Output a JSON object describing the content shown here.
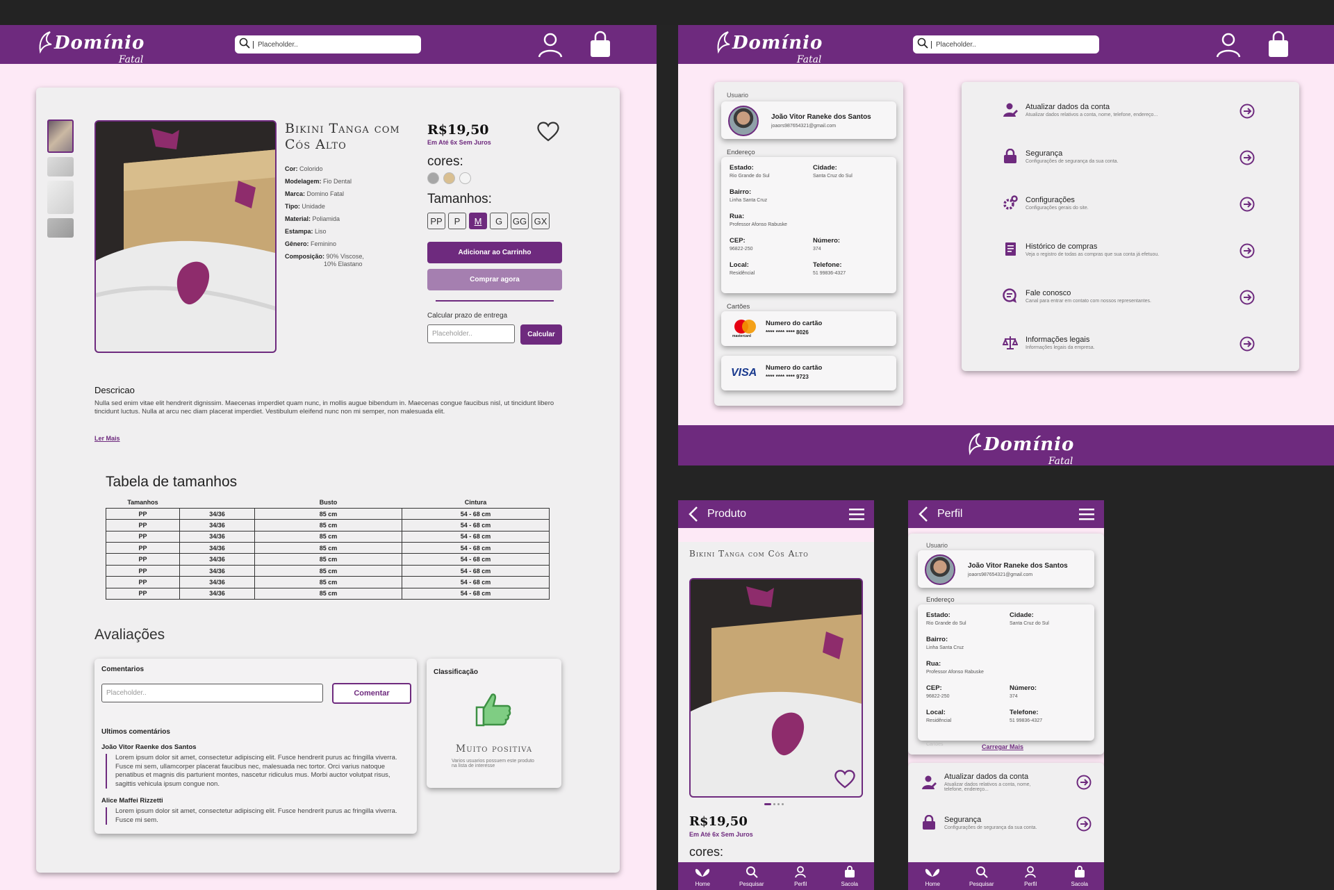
{
  "brand": {
    "name": "Domínio",
    "sub": "Fatal"
  },
  "search": {
    "placeholder": "Placeholder.."
  },
  "product": {
    "title": "Bikini Tanga com Cós Alto",
    "price": "R$19,50",
    "installments": "Em Até 6x Sem Juros",
    "colors_label": "cores:",
    "colors": [
      "#a6a6a6",
      "#d9bf91",
      "#f4f4f4"
    ],
    "sizes_label": "Tamanhos:",
    "sizes": [
      "PP",
      "P",
      "M",
      "G",
      "GG",
      "GX"
    ],
    "selected_size": "M",
    "add_cart": "Adicionar ao Carrinho",
    "buy_now": "Comprar agora",
    "shipping_label": "Calcular prazo de entrega",
    "shipping_placeholder": "Placeholder..",
    "calc_btn": "Calcular",
    "specs": [
      {
        "k": "Cor:",
        "v": "Colorido"
      },
      {
        "k": "Modelagem:",
        "v": "Fio Dental"
      },
      {
        "k": "Marca:",
        "v": "Domino Fatal"
      },
      {
        "k": "Tipo:",
        "v": "Unidade"
      },
      {
        "k": "Material:",
        "v": "Poliamida"
      },
      {
        "k": "Estampa:",
        "v": "Liso"
      },
      {
        "k": "Gênero:",
        "v": "Feminino"
      },
      {
        "k": "Composição:",
        "v": "90% Viscose,"
      },
      {
        "k": "",
        "v": "10% Elastano"
      }
    ],
    "desc_title": "Descricao",
    "desc_text": "Nulla sed enim vitae elit hendrerit dignissim. Maecenas imperdiet quam nunc, in mollis augue bibendum in. Maecenas congue faucibus nisl, ut tincidunt libero tincidunt luctus. Nulla at arcu nec diam placerat imperdiet. Vestibulum eleifend nunc non mi semper, non malesuada elit.",
    "read_more": "Ler Mais"
  },
  "size_table": {
    "title": "Tabela de tamanhos",
    "headers": [
      "Tamanhos",
      "",
      "Busto",
      "Cintura"
    ],
    "rows": [
      [
        "PP",
        "34/36",
        "85 cm",
        "54 - 68 cm"
      ],
      [
        "PP",
        "34/36",
        "85 cm",
        "54 - 68 cm"
      ],
      [
        "PP",
        "34/36",
        "85 cm",
        "54 - 68 cm"
      ],
      [
        "PP",
        "34/36",
        "85 cm",
        "54 - 68 cm"
      ],
      [
        "PP",
        "34/36",
        "85 cm",
        "54 - 68 cm"
      ],
      [
        "PP",
        "34/36",
        "85 cm",
        "54 - 68 cm"
      ],
      [
        "PP",
        "34/36",
        "85 cm",
        "54 - 68 cm"
      ],
      [
        "PP",
        "34/36",
        "85 cm",
        "54 - 68 cm"
      ]
    ]
  },
  "reviews": {
    "title": "Avaliações",
    "comments_label": "Comentarios",
    "comment_placeholder": "Placeholder..",
    "comment_btn": "Comentar",
    "latest": "Ultimos comentários",
    "items": [
      {
        "author": "João Vitor Raenke dos Santos",
        "text": "Lorem ipsum dolor sit amet, consectetur adipiscing elit. Fusce hendrerit purus ac fringilla viverra. Fusce mi sem, ullamcorper placerat faucibus nec, malesuada nec tortor. Orci varius natoque penatibus et magnis dis parturient montes, nascetur ridiculus mus. Morbi auctor volutpat risus, sagittis vehicula ipsum congue non."
      },
      {
        "author": "Alice Maffei Rizzetti",
        "text": "Lorem ipsum dolor sit amet, consectetur adipiscing elit. Fusce hendrerit purus ac fringilla viverra. Fusce mi sem."
      }
    ],
    "rating_label": "Classificação",
    "rating_value": "Muito positiva",
    "rating_note": "Varios usuarios possuem este produto na lista de interesse"
  },
  "profile": {
    "user_label": "Usuario",
    "name": "João Vitor Raneke dos Santos",
    "email": "joaors987654321@gmail.com",
    "address_label": "Endereço",
    "address": [
      {
        "k": "Estado:",
        "v": "Rio Grande do Sul"
      },
      {
        "k": "Cidade:",
        "v": "Santa Cruz do Sul"
      },
      {
        "k": "Bairro:",
        "v": "Linha Santa Cruz"
      },
      {
        "k": "Rua:",
        "v": "Professor Afonso Rabuske"
      },
      {
        "k": "CEP:",
        "v": "96822-250"
      },
      {
        "k": "Número:",
        "v": "374"
      },
      {
        "k": "Local:",
        "v": "Residêncial"
      },
      {
        "k": "Telefone:",
        "v": "51 99836-4327"
      }
    ],
    "cards_label": "Cartões",
    "cards": [
      {
        "brand": "mastercard",
        "title": "Numero do cartão",
        "num": "**** **** **** 8026"
      },
      {
        "brand": "VISA",
        "title": "Numero do cartão",
        "num": "**** **** **** 9723"
      }
    ],
    "load_more": "Carregar Mais"
  },
  "menu": [
    {
      "icon": "user-edit-icon",
      "title": "Atualizar dados da conta",
      "desc": "Atualizar dados relativos a conta, nome, telefone, endereço..."
    },
    {
      "icon": "lock-icon",
      "title": "Segurança",
      "desc": "Configurações de segurança da sua conta."
    },
    {
      "icon": "gear-icon",
      "title": "Configurações",
      "desc": "Configurações gerais do site."
    },
    {
      "icon": "receipt-icon",
      "title": "Histórico de compras",
      "desc": "Veja o registro de todas as compras que sua conta já efetuou."
    },
    {
      "icon": "chat-icon",
      "title": "Fale conosco",
      "desc": "Canal para entrar em contato com nossos representantes."
    },
    {
      "icon": "scale-icon",
      "title": "Informações legais",
      "desc": "Informações legais da empresa."
    }
  ],
  "mobile": {
    "product_header": "Produto",
    "profile_header": "Perfil",
    "nav": [
      "Home",
      "Pesquisar",
      "Perfil",
      "Sacola"
    ]
  },
  "colors": {
    "accent": "#6e2a7e",
    "bg_pink": "#fde9f6",
    "card": "#f0eff0"
  }
}
